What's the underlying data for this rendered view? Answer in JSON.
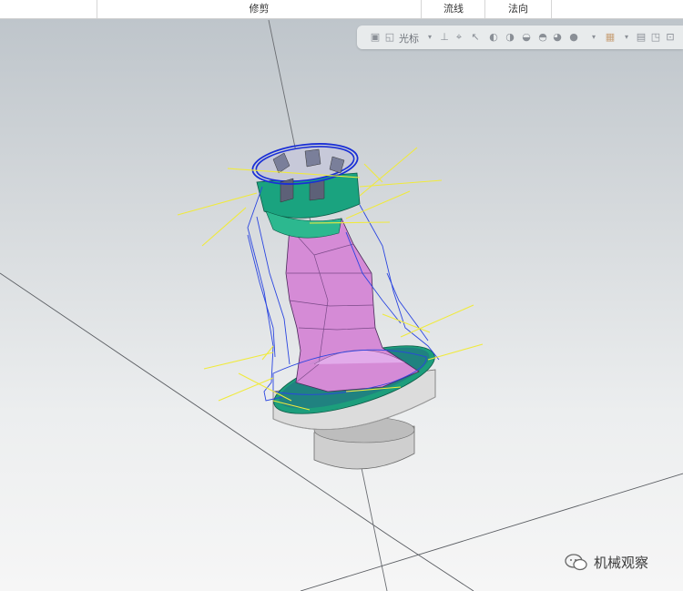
{
  "ribbon": {
    "tabs": [
      {
        "label": ""
      },
      {
        "label": "修剪"
      },
      {
        "label": "流线"
      },
      {
        "label": "法向"
      }
    ]
  },
  "toolbar": {
    "cursor_label": "光标",
    "icons": [
      "save-icon",
      "view-icon",
      "cursor-icon",
      "axis-icon",
      "target-icon",
      "arrow-icon",
      "shade1-icon",
      "shade2-icon",
      "shade3-icon",
      "shade4-icon",
      "shade5-icon",
      "render-icon",
      "color-icon",
      "grid-icon",
      "pan-icon",
      "select-icon",
      "zoom-icon"
    ]
  },
  "model": {
    "description_colors": {
      "top_ring": "#1aa37f",
      "body": "#d58bd6",
      "base_ring": "#1c9e7c",
      "pedestal": "#d2d2d2",
      "wire_blue": "#1a2fd6",
      "wire_yellow": "#f3f044"
    }
  },
  "watermark": {
    "text": "机械观察"
  }
}
